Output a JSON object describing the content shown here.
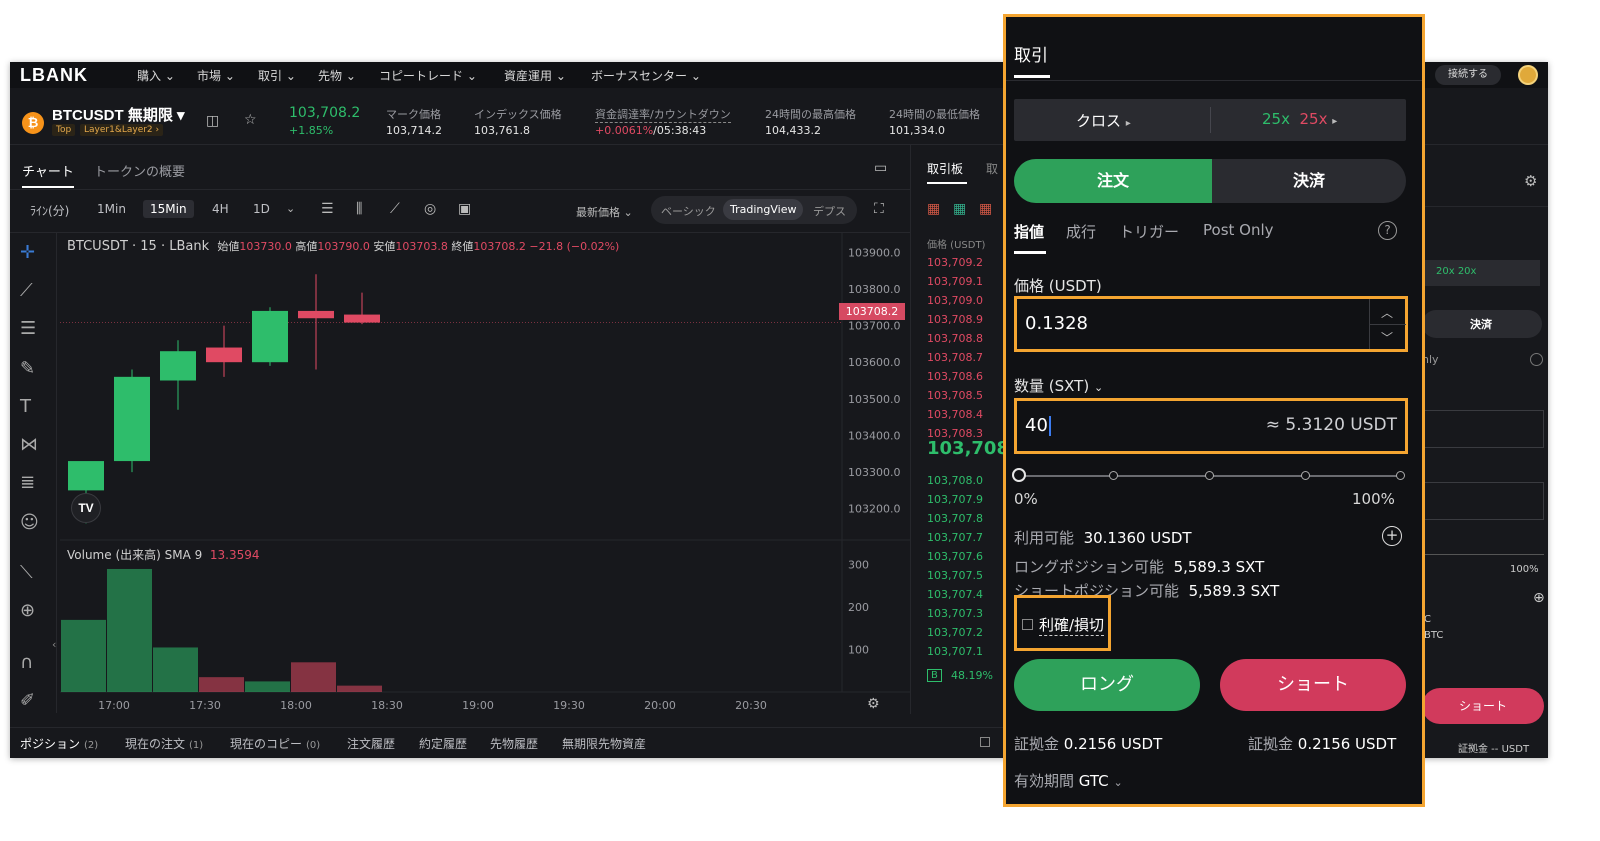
{
  "nav": {
    "logo": "LBANK",
    "items": [
      "購入",
      "市場",
      "取引",
      "先物",
      "コピートレード",
      "資産運用",
      "ボーナスセンター"
    ],
    "connect": "接続する"
  },
  "ticker": {
    "symbol": "BTCUSDT 無期限",
    "tag1": "Top",
    "tag2": "Layer1&Layer2",
    "last": "103,708.2",
    "change": "+1.85%",
    "mark_label": "マーク価格",
    "mark": "103,714.2",
    "index_label": "インデックス価格",
    "index": "103,761.8",
    "funding_label": "資金調達率/カウントダウン",
    "funding_rate": "+0.0061%",
    "funding_cd": "/05:38:43",
    "high_label": "24時間の最高価格",
    "high": "104,433.2",
    "low_label": "24時間の最低価格",
    "low": "101,334.0"
  },
  "chart_tabs": [
    "チャート",
    "トークンの概要"
  ],
  "timeframes": [
    "ﾗｲﾝ(分)",
    "1Min",
    "15Min",
    "4H",
    "1D"
  ],
  "latest_price": "最新価格",
  "views": [
    "ベーシック",
    "TradingView",
    "デプス"
  ],
  "ohlc": {
    "title": "BTCUSDT · 15 · LBank",
    "o_label": "始値",
    "o": "103730.0",
    "h_label": "高値",
    "h": "103790.0",
    "l_label": "安値",
    "l": "103703.8",
    "c_label": "終値",
    "c": "103708.2",
    "chg": "−21.8 (−0.02%)"
  },
  "volume": {
    "label": "Volume (出来高) SMA 9",
    "value": "13.3594"
  },
  "price_badge": "103708.2",
  "tv_logo": "TV",
  "colors": {
    "up": "#2ebd6b",
    "down": "#e04a63",
    "accent": "#f4a531"
  },
  "chart_data": {
    "type": "candlestick",
    "ylim": [
      103150,
      103950
    ],
    "yticks": [
      "103900.0",
      "103800.0",
      "103700.0",
      "103600.0",
      "103500.0",
      "103400.0",
      "103300.0",
      "103200.0"
    ],
    "volume_ticks": [
      "300",
      "200",
      "100"
    ],
    "volume_max": 330,
    "x_ticks": [
      "17:00",
      "17:30",
      "18:00",
      "18:30",
      "19:00",
      "19:30",
      "20:00",
      "20:30"
    ],
    "candles": [
      {
        "o": 103250,
        "h": 103320,
        "l": 103160,
        "c": 103330
      },
      {
        "o": 103330,
        "h": 103580,
        "l": 103300,
        "c": 103560
      },
      {
        "o": 103550,
        "h": 103660,
        "l": 103470,
        "c": 103630
      },
      {
        "o": 103640,
        "h": 103700,
        "l": 103560,
        "c": 103600
      },
      {
        "o": 103600,
        "h": 103750,
        "l": 103590,
        "c": 103740
      },
      {
        "o": 103740,
        "h": 103840,
        "l": 103580,
        "c": 103720
      },
      {
        "o": 103730,
        "h": 103790,
        "l": 103703.8,
        "c": 103708.2
      }
    ],
    "volumes": [
      {
        "v": 170,
        "up": true
      },
      {
        "v": 290,
        "up": true
      },
      {
        "v": 105,
        "up": true
      },
      {
        "v": 35,
        "up": false
      },
      {
        "v": 25,
        "up": true
      },
      {
        "v": 70,
        "up": false
      },
      {
        "v": 15,
        "up": false
      }
    ]
  },
  "orderbook": {
    "tabs": [
      "取引板",
      "取"
    ],
    "header": "価格 (USDT)",
    "asks": [
      "103,709.2",
      "103,709.1",
      "103,709.0",
      "103,708.9",
      "103,708.8",
      "103,708.7",
      "103,708.6",
      "103,708.5",
      "103,708.4",
      "103,708.3"
    ],
    "mid": "103,708",
    "bids": [
      "103,708.0",
      "103,707.9",
      "103,707.8",
      "103,707.7",
      "103,707.6",
      "103,707.5",
      "103,707.4",
      "103,707.3",
      "103,707.2",
      "103,707.1"
    ],
    "ratio_b": "B",
    "ratio": "48.19%"
  },
  "bottom_tabs": [
    {
      "label": "ポジション",
      "count": "(2)"
    },
    {
      "label": "現在の注文",
      "count": "(1)"
    },
    {
      "label": "現在のコピー",
      "count": "(0)"
    },
    {
      "label": "注文履歴",
      "count": ""
    },
    {
      "label": "約定履歴",
      "count": ""
    },
    {
      "label": "先物履歴",
      "count": ""
    },
    {
      "label": "無期限先物資産",
      "count": ""
    }
  ],
  "behind": {
    "lev": "20x 20x",
    "close": "決済",
    "only": "nly",
    "pct": "100%",
    "c": "C",
    "btc": "BTC",
    "short": "ショート",
    "margin": "証拠金 --  USDT"
  },
  "panel": {
    "title": "取引",
    "margin_mode": "クロス",
    "lev_long": "25x",
    "lev_short": "25x",
    "open": "注文",
    "close": "決済",
    "order_types": [
      "指値",
      "成行",
      "トリガー",
      "Post Only"
    ],
    "help": "?",
    "price_label": "価格 (USDT)",
    "price_value": "0.1328",
    "qty_label": "数量 (SXT)",
    "qty_value": "40",
    "qty_usdt": "≈ 5.3120 USDT",
    "slider_value": 0,
    "pct_min": "0%",
    "pct_max": "100%",
    "avail_label": "利用可能",
    "avail_value": "30.1360 USDT",
    "long_avail_label": "ロングポジション可能",
    "long_avail_value": "5,589.3 SXT",
    "short_avail_label": "ショートポジション可能",
    "short_avail_value": "5,589.3 SXT",
    "tpsl": "利確/損切",
    "long_btn": "ロング",
    "short_btn": "ショート",
    "margin_label": "証拠金",
    "margin_long": "0.2156  USDT",
    "margin_short": "0.2156  USDT",
    "validity_label": "有効期間",
    "validity_value": "GTC"
  }
}
